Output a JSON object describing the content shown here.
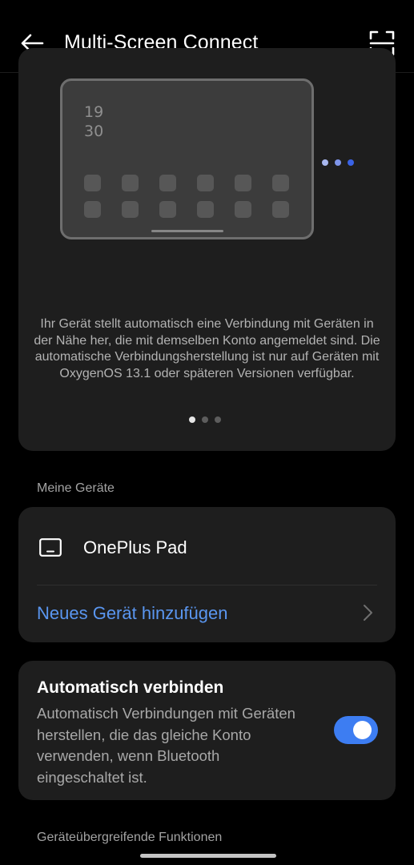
{
  "header": {
    "title": "Multi-Screen Connect",
    "back_icon": "arrow-left-icon",
    "scan_icon": "scan-frame-icon"
  },
  "hero": {
    "tablet_time_hour": "19",
    "tablet_time_minute": "30",
    "description": "Ihr Gerät stellt automatisch eine Verbindung mit Geräten in der Nähe her, die mit demselben Konto angemeldet sind. Die automatische Verbindungsherstellung ist nur auf Geräten mit OxygenOS 13.1 oder späteren Versionen verfügbar.",
    "pager_count": 3,
    "pager_active": 0,
    "dot_colors": [
      "#a9b8ef",
      "#7f95ea",
      "#3a63e6"
    ]
  },
  "my_devices": {
    "section_label": "Meine Geräte",
    "device_name": "OnePlus Pad",
    "device_icon": "tablet-icon",
    "add_label": "Neues Gerät hinzufügen"
  },
  "auto_connect": {
    "title": "Automatisch verbinden",
    "description": "Automatisch Verbindungen mit Geräten herstellen, die das gleiche Konto verwenden, wenn Bluetooth eingeschaltet ist.",
    "enabled": true
  },
  "cross_device": {
    "section_label": "Geräteübergreifende Funktionen"
  },
  "colors": {
    "accent": "#3d7df2",
    "link": "#5a96f0",
    "card": "#1e1e1e",
    "background": "#000000"
  }
}
